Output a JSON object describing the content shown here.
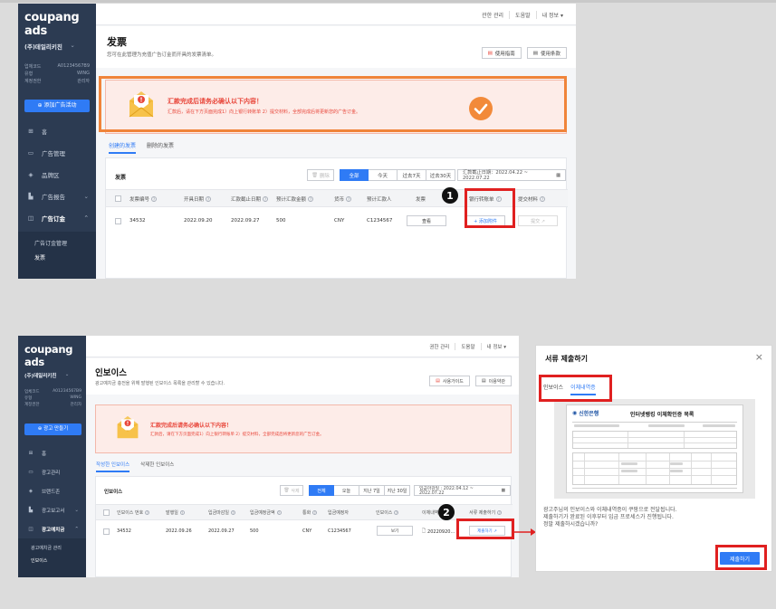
{
  "colors": {
    "brand_blue": "#2f7bf5",
    "sidebar": "#2c3b52",
    "alert_red": "#e8463a",
    "highlight_red": "#e02020",
    "highlight_orange": "#f0843a",
    "check_orange": "#f28a3a"
  },
  "top": {
    "logo": "coupang ads",
    "company": "(주)데일리키친",
    "info": [
      {
        "label": "업체코드",
        "value": "A01234567B9"
      },
      {
        "label": "유형",
        "value": "WING"
      },
      {
        "label": "계정권한",
        "value": "관리자"
      }
    ],
    "new_campaign": "添加广告活动",
    "nav": [
      {
        "icon": "grid-icon",
        "label": "홈"
      },
      {
        "icon": "folder-icon",
        "label": "广告管理"
      },
      {
        "icon": "layers-icon",
        "label": "品牌区"
      },
      {
        "icon": "bar-chart-icon",
        "label": "广告报告"
      },
      {
        "icon": "wallet-icon",
        "label": "广告订金"
      }
    ],
    "sub_nav": [
      "广告订金管理",
      "发票"
    ],
    "topbar_links": [
      "관한 관리",
      "도움말",
      "내 정보 ▾"
    ],
    "page_title": "发票",
    "page_desc": "您可在此管理为充值广告订金而开具的发票清单。",
    "btn_guide": "使用指南",
    "btn_terms": "使用条款",
    "alert_title": "汇款完成后请务必确认以下内容！",
    "alert_body": "汇款后，请在下方页面完成1）向上银行转账单 2）提交材料，全部完成后将更新您的广告订金。",
    "tabs": [
      "创建的发票",
      "删除的发票"
    ],
    "card_title": "发票",
    "filters": [
      "删除",
      "全部",
      "今天",
      "过去7天",
      "过去30天"
    ],
    "date_label": "汇款截止日期：2022.04.22 ~ 2022.07.22",
    "columns": [
      "发票编号",
      "开具日期",
      "汇款截止日期",
      "预计汇款金额",
      "货币",
      "预计汇款人",
      "发票",
      "银行转账单",
      "提交材料"
    ],
    "row": {
      "invoice": "34532",
      "issued": "2022.09.20",
      "due": "2022.09.27",
      "amount": "500",
      "currency": "CNY",
      "payer": "C1234567",
      "view": "查看",
      "upload": "+ 添加附件",
      "submit": "提交 ↗"
    }
  },
  "bottom": {
    "logo": "coupang ads",
    "company": "(주)데일리키친",
    "info": [
      {
        "label": "업체코드",
        "value": "A01234567B9"
      },
      {
        "label": "유형",
        "value": "WING"
      },
      {
        "label": "계정권한",
        "value": "관리자"
      }
    ],
    "new_campaign": "광고 만들기",
    "nav": [
      {
        "icon": "grid-icon",
        "label": "홈"
      },
      {
        "icon": "folder-icon",
        "label": "광고관리"
      },
      {
        "icon": "layers-icon",
        "label": "브랜드존"
      },
      {
        "icon": "bar-chart-icon",
        "label": "광고보고서"
      },
      {
        "icon": "wallet-icon",
        "label": "광고예치금"
      }
    ],
    "sub_nav": [
      "광고예치금 관리",
      "인보이스"
    ],
    "topbar_links": [
      "권한 관리",
      "도움말",
      "내 정보 ▾"
    ],
    "page_title": "인보이스",
    "page_desc": "광고예치금 충전을 위해 발행된 인보이스 목록을 관리할 수 있습니다.",
    "btn_guide": "사용가이드",
    "btn_terms": "이용약관",
    "alert_title": "汇款完成后请务必确认以下内容！",
    "alert_body": "汇款后，请在下方页面完成1）向上银行转账单 2）提交材料，全部完成后将更新您的广告订金。",
    "tabs": [
      "작성한 인보이스",
      "삭제한 인보이스"
    ],
    "card_title": "인보이스",
    "filters": [
      "삭제",
      "전체",
      "오늘",
      "지난 7일",
      "지난 30일"
    ],
    "date_label": "입금마감일 : 2022.04.12 ~ 2022.07.22",
    "columns": [
      "인보이스 번호",
      "발행일",
      "입금마감일",
      "입금예정금액",
      "통화",
      "입금예정자",
      "인보이스",
      "이체내역",
      "서류 제출하기"
    ],
    "row": {
      "invoice": "34532",
      "issued": "2022.09.26",
      "due": "2022.09.27",
      "amount": "500",
      "currency": "CNY",
      "payer": "C1234567",
      "view": "보기",
      "transfer": "20220920...",
      "submit": "제출하기 ↗"
    }
  },
  "modal": {
    "title": "서류 제출하기",
    "close": "×",
    "tabs": [
      "인보이스",
      "이체내역증"
    ],
    "doc_bank": "신한은행",
    "doc_title": "인터넷뱅킹 이체확인증 목록",
    "message": [
      "광고주님의 인보이스와 이체내역증이 쿠팡으로 전달됩니다.",
      "제출하기가 완료된 이후부터 입금 프로세스가 진행됩니다.",
      "정말 제출하시겠습니까?"
    ],
    "submit": "제출하기"
  },
  "markers": [
    "1",
    "2"
  ]
}
